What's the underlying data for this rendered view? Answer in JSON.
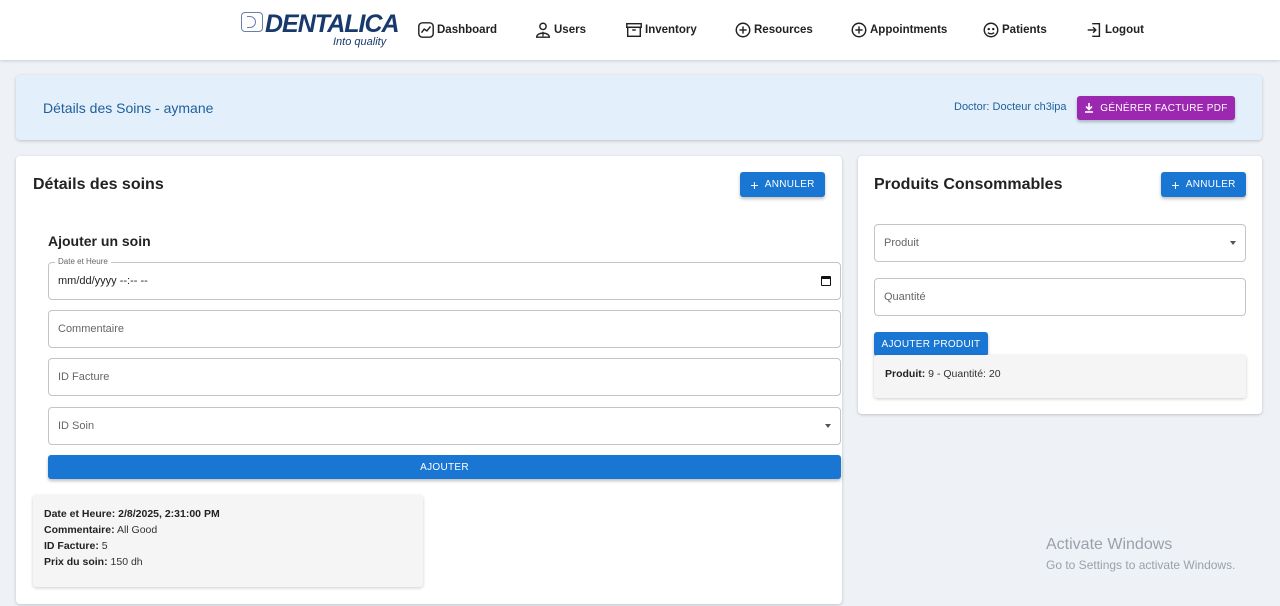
{
  "brand": {
    "name": "DENTALICA",
    "tagline": "Into quality"
  },
  "nav": [
    {
      "label": "Dashboard",
      "icon": "chart-line-icon"
    },
    {
      "label": "Users",
      "icon": "user-doctor-icon"
    },
    {
      "label": "Inventory",
      "icon": "archive-box-icon"
    },
    {
      "label": "Resources",
      "icon": "plus-circle-icon"
    },
    {
      "label": "Appointments",
      "icon": "plus-circle-icon"
    },
    {
      "label": "Patients",
      "icon": "face-icon"
    },
    {
      "label": "Logout",
      "icon": "logout-icon"
    }
  ],
  "header": {
    "title": "Détails des Soins - aymane",
    "doctor": "Doctor: Docteur ch3ipa",
    "generate_label": "GÉNÉRER FACTURE PDF"
  },
  "soins": {
    "title": "Détails des soins",
    "cancel_label": "ANNULER",
    "form_title": "Ajouter un soin",
    "date_label": "Date et Heure",
    "date_value": "mm/dd/yyyy --:-- --",
    "comment_placeholder": "Commentaire",
    "facture_placeholder": "ID Facture",
    "soin_placeholder": "ID Soin",
    "add_label": "AJOUTER",
    "record": {
      "date_label": "Date et Heure:",
      "date_value": "2/8/2025, 2:31:00 PM",
      "comment_label": "Commentaire:",
      "comment_value": "All Good",
      "facture_label": "ID Facture:",
      "facture_value": "5",
      "prix_label": "Prix du soin:",
      "prix_value": "150 dh"
    }
  },
  "produits": {
    "title": "Produits Consommables",
    "cancel_label": "ANNULER",
    "produit_placeholder": "Produit",
    "quantite_placeholder": "Quantité",
    "add_label": "AJOUTER PRODUIT",
    "item": {
      "produit_label": "Produit:",
      "produit_value": "9",
      "quantite_text": "- Quantité: 20"
    }
  },
  "watermark": {
    "line1": "Activate Windows",
    "line2": "Go to Settings to activate Windows."
  },
  "colors": {
    "primary": "#1976d2",
    "secondary": "#9c27b0",
    "header_bg": "#e3f0fb",
    "brand": "#17396b"
  }
}
